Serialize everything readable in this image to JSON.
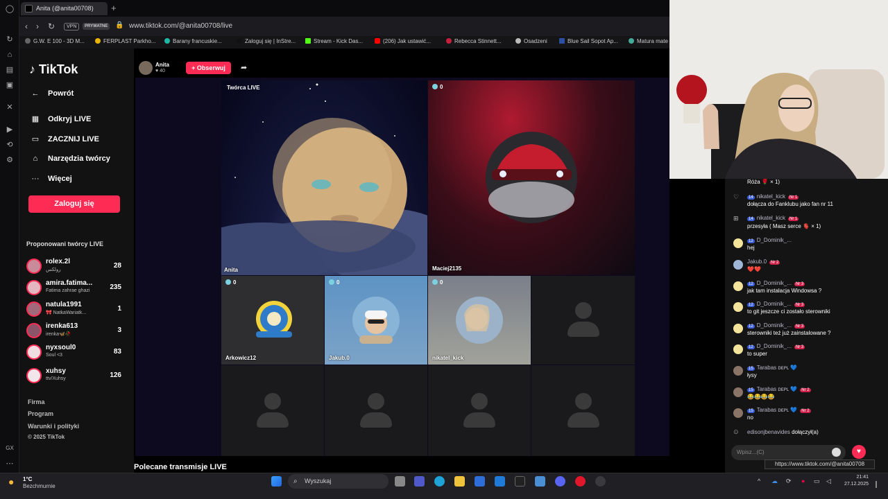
{
  "browser": {
    "tab_title": "Anita (@anita00708)",
    "new_tab": "+",
    "vpn_badge": "VPN",
    "private_badge": "PRYWATNE",
    "url": "www.tiktok.com/@anita00708/live",
    "bookmarks": [
      "G.W. E 100 - 3D M...",
      "FERPLAST Parkho...",
      "Barany francuskie...",
      "Zaloguj się | InStre...",
      "Stream - Kick Das...",
      "(206) Jak ustawić...",
      "Rebecca Stinnett...",
      "Osadzeni",
      "Blue Sail Sopot Ap...",
      "Matura mate"
    ]
  },
  "sidebar": {
    "logo": "TikTok",
    "nav": [
      {
        "label": "Powrót",
        "icon": "arrow-left-icon"
      },
      {
        "label": "Odkryj LIVE",
        "icon": "live-tv-icon"
      },
      {
        "label": "ZACZNIJ LIVE",
        "icon": "video-camera-icon"
      },
      {
        "label": "Narzędzia twórcy",
        "icon": "home-tools-icon"
      },
      {
        "label": "Więcej",
        "icon": "more-dots-icon"
      }
    ],
    "login": "Zaloguj się",
    "suggested_title": "Proponowani twórcy LIVE",
    "creators": [
      {
        "name": "rolex.2l",
        "sub": "رولكس",
        "count": "28"
      },
      {
        "name": "amira.fatima...",
        "sub": "Fatima zahrae ghazi",
        "count": "235"
      },
      {
        "name": "natula1991",
        "sub": "🎀 NatkaWariatk...",
        "count": "1"
      },
      {
        "name": "irenka613",
        "sub": "irenka🦋🥀",
        "count": "3"
      },
      {
        "name": "nyxsoul0",
        "sub": "Soul <3",
        "count": "83"
      },
      {
        "name": "xuhsy",
        "sub": "ttv/Xuhsy",
        "count": "126"
      }
    ],
    "footer": [
      "Firma",
      "Program",
      "Warunki i polityki",
      "© 2025 TikTok"
    ]
  },
  "live": {
    "host_name": "Anita",
    "host_likes": "♥ 40",
    "follow": "+ Obserwuj",
    "creator_tag": "Twórca LIVE",
    "tiles": [
      {
        "name": "Anita",
        "count": ""
      },
      {
        "name": "Maciej2135",
        "count": "0"
      },
      {
        "name": "Arkowicz12",
        "count": "0"
      },
      {
        "name": "Jakub.0",
        "count": "0"
      },
      {
        "name": "nikatel_kick",
        "count": "0"
      }
    ],
    "recommended": "Polecane transmisje LIVE"
  },
  "chat": {
    "messages": [
      {
        "user": "",
        "level": "",
        "badge": "",
        "text": "Róża 🌹 × 1)"
      },
      {
        "user": "nikatel_kick",
        "level": "14",
        "badge": "Nr 1",
        "text": "dołącza do Fanklubu jako fan nr 11"
      },
      {
        "user": "nikatel_kick",
        "level": "14",
        "badge": "Nr 1",
        "text": "przesyła ( Masz serce 🫀 × 1)"
      },
      {
        "user": "D_Dominik_...",
        "level": "12",
        "badge": "",
        "text": "hej"
      },
      {
        "user": "Jakub.0",
        "level": "",
        "badge": "Nr 2",
        "text": "❤️❤️"
      },
      {
        "user": "D_Dominik_...",
        "level": "12",
        "badge": "Nr 3",
        "text": "jak tam instalacja Windowsa ?"
      },
      {
        "user": "D_Dominik_...",
        "level": "12",
        "badge": "Nr 3",
        "text": "to git jeszcze ci zostało sterowniki"
      },
      {
        "user": "D_Dominik_...",
        "level": "12",
        "badge": "Nr 3",
        "text": "sterowniki też już zainstalowane ?"
      },
      {
        "user": "D_Dominik_...",
        "level": "12",
        "badge": "Nr 3",
        "text": "to super"
      },
      {
        "user": "Tarabas ᴅᴇᴘʟ 💙",
        "level": "15",
        "badge": "",
        "text": "łysy"
      },
      {
        "user": "Tarabas ᴅᴇᴘʟ 💙",
        "level": "15",
        "badge": "Nr 2",
        "text": "😂😂😂😂"
      },
      {
        "user": "Tarabas ᴅᴇᴘʟ 💙",
        "level": "15",
        "badge": "Nr 2",
        "text": "no"
      }
    ],
    "join_user": "edisonjbenavides",
    "join_text": "dołączył(a)",
    "input_placeholder": "Wpisz...(C)",
    "tooltip": "https://www.tiktok.com/@anita00708"
  },
  "taskbar": {
    "temp": "1°C",
    "weather": "Bezchmurnie",
    "search": "Wyszukaj",
    "time": "21:41",
    "date": "27.12.2025"
  }
}
